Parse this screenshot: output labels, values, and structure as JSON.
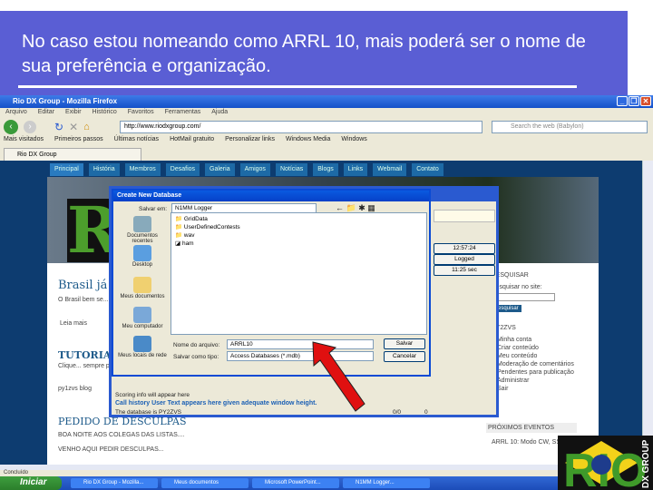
{
  "slide": {
    "title": "No caso estou nomeando como ARRL 10, mais poderá ser o nome de sua preferência e organização."
  },
  "browser": {
    "window_title": "Rio DX Group - Mozilla Firefox",
    "menu": [
      "Arquivo",
      "Editar",
      "Exibir",
      "Histórico",
      "Favoritos",
      "Ferramentas",
      "Ajuda"
    ],
    "url": "http://www.riodxgroup.com/",
    "search_placeholder": "Search the web (Babylon)",
    "bookmarks": [
      "Mais visitados",
      "Primeiros passos",
      "Últimas notícias",
      "HotMail gratuito",
      "Personalizar links",
      "Windows Media",
      "Windows"
    ],
    "tab": "Rio DX Group",
    "status": "Concluído"
  },
  "site": {
    "nav": [
      "Principal",
      "História",
      "Membros",
      "Desafios",
      "Galeria",
      "Amigos",
      "Notícias",
      "Blogs",
      "Links",
      "Webmail",
      "Contato"
    ],
    "article1_title": "Brasil já fa...",
    "article1_text": "O Brasil bem se... radioamadores...",
    "read_more": "Leia mais",
    "tutorial_title": "TUTORIAL",
    "tutorial_text": "Clique... sempre possível...",
    "blog_link": "py1zvs blog",
    "apology_title": "PEDIDO DE DESCULPAS",
    "apology_text1": "BOA NOITE AOS COLEGAS DAS LISTAS....",
    "apology_text2": "VENHO AQUI PEDIR DESCULPAS...",
    "search_heading": "PESQUISAR",
    "search_label": "Pesquisar no site:",
    "search_button": "Pesquisar",
    "user_heading": "PY2ZVS",
    "user_menu": [
      "Minha conta",
      "Criar conteúdo",
      "Meu conteúdo",
      "Moderação de comentários",
      "Pendentes para publicação",
      "Administrar",
      "Sair"
    ],
    "events_heading": "PRÓXIMOS EVENTOS",
    "event": "ARRL 10: Modo CW, SSB"
  },
  "n1mm": {
    "status_line": "Call history User Text appears here given adequate window height.",
    "scoring": "Scoring info will appear here",
    "db_line": "The database is PY2ZVS",
    "count": "0/0",
    "zero": "0",
    "side_buttons": [
      "12:57:24",
      "Logged",
      "11:25 sec"
    ]
  },
  "dialog": {
    "title": "Create New Database",
    "save_in_label": "Salvar em:",
    "save_in": "N1MM Logger",
    "places": [
      "Documentos recentes",
      "Desktop",
      "Meus documentos",
      "Meu computador",
      "Meus locais de rede"
    ],
    "files": [
      "GridData",
      "UserDefinedContests",
      "wav",
      "ham"
    ],
    "filename_label": "Nome do arquivo:",
    "filename": "ARRL10",
    "type_label": "Salvar como tipo:",
    "type": "Access Databases (*.mdb)",
    "save": "Salvar",
    "cancel": "Cancelar"
  },
  "taskbar": {
    "start": "Iniciar",
    "tasks": [
      "Rio DX Group - Mozilla...",
      "Meus documentos",
      "Microsoft PowerPoint...",
      "N1MM Logger..."
    ]
  },
  "logo": {
    "text": "RIO",
    "subtext": "DX GROUP"
  },
  "colors": {
    "slide_band": "#5a5ed4",
    "arrow": "#e01010",
    "site_bg": "#0d3c70"
  }
}
